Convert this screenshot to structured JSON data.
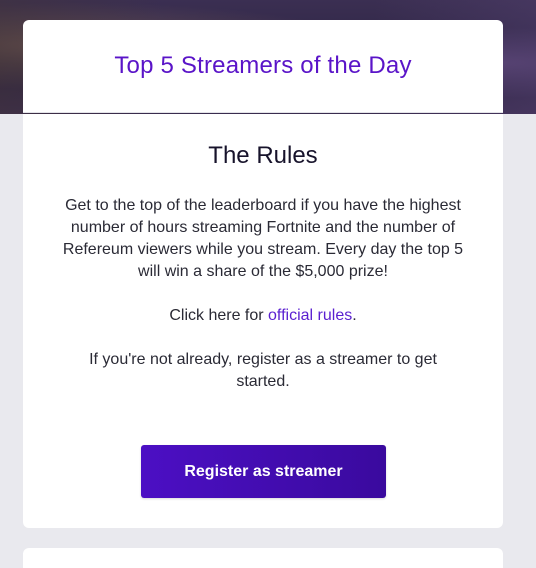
{
  "header": {
    "title": "Top 5 Streamers of the Day"
  },
  "rules": {
    "heading": "The Rules",
    "paragraph_1": "Get to the top of the leaderboard if you have the highest number of hours streaming Fortnite and the number of Refereum viewers while you stream. Every day the top 5 will win a share of the $5,000 prize!",
    "click_here_prefix": "Click here for ",
    "official_rules_link": "official rules",
    "click_here_suffix": ".",
    "paragraph_3": "If you're not already, register as a streamer to get started.",
    "register_button": "Register as streamer"
  },
  "colors": {
    "accent": "#5a14c8",
    "button_start": "#4c0fc4",
    "button_end": "#3a0a9e",
    "page_background": "#e9e9ee"
  }
}
